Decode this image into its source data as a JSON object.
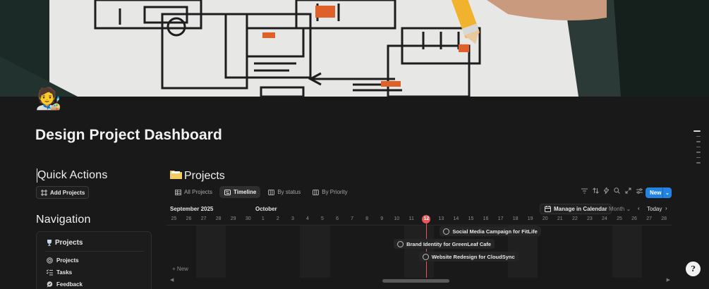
{
  "page": {
    "icon": "🧑‍🎨",
    "title": "Design Project Dashboard"
  },
  "quick_actions": {
    "heading": "Quick Actions",
    "add_projects": "Add Projects"
  },
  "navigation": {
    "heading": "Navigation",
    "box_title": "Projects",
    "items": [
      {
        "label": "Projects",
        "icon": "target-icon"
      },
      {
        "label": "Tasks",
        "icon": "checklist-icon"
      },
      {
        "label": "Feedback",
        "icon": "chat-icon"
      }
    ]
  },
  "projects": {
    "title": "Projects",
    "tabs": [
      {
        "label": "All Projects",
        "icon": "table-icon",
        "active": false
      },
      {
        "label": "Timeline",
        "icon": "timeline-icon",
        "active": true
      },
      {
        "label": "By status",
        "icon": "board-icon",
        "active": false
      },
      {
        "label": "By Priority",
        "icon": "board-icon",
        "active": false
      }
    ],
    "new_button": "New",
    "toolbar_icons": [
      "filter-icon",
      "sort-icon",
      "lightning-icon",
      "search-icon",
      "expand-icon",
      "settings-icon"
    ]
  },
  "timeline": {
    "month_left": "September 2025",
    "month_right": "October",
    "manage_calendar": "Manage in Calendar",
    "scale": "Month",
    "today_label": "Today",
    "days": [
      "25",
      "26",
      "27",
      "28",
      "29",
      "30",
      "1",
      "2",
      "3",
      "4",
      "5",
      "6",
      "7",
      "8",
      "9",
      "10",
      "11",
      "12",
      "13",
      "14",
      "15",
      "16",
      "17",
      "18",
      "19",
      "20",
      "21",
      "22",
      "23",
      "24",
      "25",
      "26",
      "27",
      "28"
    ],
    "today_day": "12",
    "items": [
      {
        "label": "Social Media Campaign for FitLife"
      },
      {
        "label": "Brand Identity for GreenLeaf Cafe"
      },
      {
        "label": "Website Redesign for CloudSync"
      }
    ],
    "new_row": "+ New"
  },
  "colors": {
    "accent": "#2383e2",
    "today": "#eb5757",
    "background": "#191919"
  }
}
